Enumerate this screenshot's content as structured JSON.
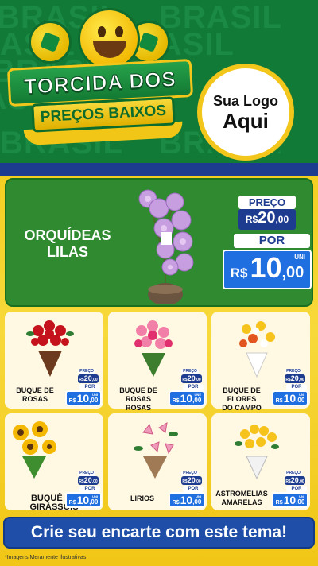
{
  "header": {
    "background_word": "BRASIL",
    "campaign_line1": "TORCIDA DOS",
    "campaign_line2": "PREÇOS BAIXOS",
    "logo_line1": "Sua Logo",
    "logo_line2": "Aqui"
  },
  "featured": {
    "name_line1": "ORQUÍDEAS",
    "name_line2": "LILAS",
    "price_label": "PREÇO",
    "old_currency": "R$",
    "old_value": "20",
    "old_cents": ",00",
    "por_label": "POR",
    "uni_label": "UNI",
    "new_currency": "R$",
    "new_value": "10",
    "new_cents": ",00"
  },
  "products": [
    {
      "name_line1": "BUQUE DE",
      "name_line2": "ROSAS",
      "price_label": "PREÇO",
      "old_currency": "R$",
      "old_value": "20",
      "old_cents": ",00",
      "por_label": "POR",
      "uni_label": "UNI",
      "new_currency": "R$",
      "new_value": "10",
      "new_cents": ",00"
    },
    {
      "name_line1": "BUQUE DE ROSAS",
      "name_line2": "ROSAS",
      "price_label": "PREÇO",
      "old_currency": "R$",
      "old_value": "20",
      "old_cents": ",00",
      "por_label": "POR",
      "uni_label": "UNE",
      "new_currency": "R$",
      "new_value": "10",
      "new_cents": ",00"
    },
    {
      "name_line1": "BUQUE DE FLORES",
      "name_line2": "DO CAMPO",
      "price_label": "PREÇO",
      "old_currency": "R$",
      "old_value": "20",
      "old_cents": ",00",
      "por_label": "POR",
      "uni_label": "UNI",
      "new_currency": "R$",
      "new_value": "10",
      "new_cents": ",00"
    },
    {
      "name_line1": "BUQUÊ DE GIRASSÓIS",
      "name_line2": "",
      "price_label": "PREÇO",
      "old_currency": "R$",
      "old_value": "20",
      "old_cents": ",00",
      "por_label": "POR",
      "uni_label": "UNI",
      "new_currency": "R$",
      "new_value": "10",
      "new_cents": ",00"
    },
    {
      "name_line1": "LIRIOS",
      "name_line2": "",
      "price_label": "PREÇO",
      "old_currency": "R$",
      "old_value": "20",
      "old_cents": ",00",
      "por_label": "POR",
      "uni_label": "UNI",
      "new_currency": "R$",
      "new_value": "10",
      "new_cents": ",00"
    },
    {
      "name_line1": "ASTROMELIAS",
      "name_line2": "AMARELAS",
      "price_label": "PREÇO",
      "old_currency": "R$",
      "old_value": "20",
      "old_cents": ",00",
      "por_label": "POR",
      "uni_label": "UNI",
      "new_currency": "R$",
      "new_value": "10",
      "new_cents": ",00"
    }
  ],
  "cta": {
    "label": "Crie seu encarte com este tema!"
  },
  "footnote": "*Imagens Meramente Ilustrativas",
  "colors": {
    "green": "#117a37",
    "yellow": "#f4cf22",
    "blue": "#1d3b8f",
    "price_blue": "#1f6fe0"
  }
}
